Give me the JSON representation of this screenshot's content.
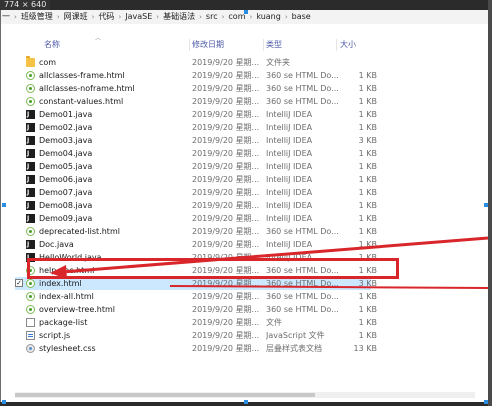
{
  "capture_size": "774 × 640",
  "breadcrumb": [
    "一",
    "班级管理",
    "网课班",
    "代码",
    "JavaSE",
    "基础语法",
    "src",
    "com",
    "kuang",
    "base"
  ],
  "columns": {
    "name": "名称",
    "date": "修改日期",
    "type": "类型",
    "size": "大小"
  },
  "files": [
    {
      "name": "com",
      "date": "2019/9/20 星期...",
      "type": "文件夹",
      "size": "",
      "icon": "folder-icon"
    },
    {
      "name": "allclasses-frame.html",
      "date": "2019/9/20 星期...",
      "type": "360 se HTML Do...",
      "size": "1 KB",
      "icon": "html-icon"
    },
    {
      "name": "allclasses-noframe.html",
      "date": "2019/9/20 星期...",
      "type": "360 se HTML Do...",
      "size": "1 KB",
      "icon": "html-icon"
    },
    {
      "name": "constant-values.html",
      "date": "2019/9/20 星期...",
      "type": "360 se HTML Do...",
      "size": "1 KB",
      "icon": "html-icon"
    },
    {
      "name": "Demo01.java",
      "date": "2019/9/20 星期...",
      "type": "IntelliJ IDEA",
      "size": "1 KB",
      "icon": "java-icon"
    },
    {
      "name": "Demo02.java",
      "date": "2019/9/20 星期...",
      "type": "IntelliJ IDEA",
      "size": "1 KB",
      "icon": "java-icon"
    },
    {
      "name": "Demo03.java",
      "date": "2019/9/20 星期...",
      "type": "IntelliJ IDEA",
      "size": "3 KB",
      "icon": "java-icon"
    },
    {
      "name": "Demo04.java",
      "date": "2019/9/20 星期...",
      "type": "IntelliJ IDEA",
      "size": "1 KB",
      "icon": "java-icon"
    },
    {
      "name": "Demo05.java",
      "date": "2019/9/20 星期...",
      "type": "IntelliJ IDEA",
      "size": "1 KB",
      "icon": "java-icon"
    },
    {
      "name": "Demo06.java",
      "date": "2019/9/20 星期...",
      "type": "IntelliJ IDEA",
      "size": "1 KB",
      "icon": "java-icon"
    },
    {
      "name": "Demo07.java",
      "date": "2019/9/20 星期...",
      "type": "IntelliJ IDEA",
      "size": "1 KB",
      "icon": "java-icon"
    },
    {
      "name": "Demo08.java",
      "date": "2019/9/20 星期...",
      "type": "IntelliJ IDEA",
      "size": "1 KB",
      "icon": "java-icon"
    },
    {
      "name": "Demo09.java",
      "date": "2019/9/20 星期...",
      "type": "IntelliJ IDEA",
      "size": "1 KB",
      "icon": "java-icon"
    },
    {
      "name": "deprecated-list.html",
      "date": "2019/9/20 星期...",
      "type": "360 se HTML Do...",
      "size": "1 KB",
      "icon": "html-icon"
    },
    {
      "name": "Doc.java",
      "date": "2019/9/20 星期...",
      "type": "IntelliJ IDEA",
      "size": "1 KB",
      "icon": "java-icon"
    },
    {
      "name": "HelloWorld.java",
      "date": "2019/9/20 星期...",
      "type": "IntelliJ IDEA",
      "size": "1 KB",
      "icon": "java-icon"
    },
    {
      "name": "help-doc.html",
      "date": "2019/9/20 星期...",
      "type": "360 se HTML Do...",
      "size": "1 KB",
      "icon": "html-icon"
    },
    {
      "name": "index.html",
      "date": "2019/9/20 星期...",
      "type": "360 se HTML Do...",
      "size": "3 KB",
      "icon": "html-icon",
      "selected": true
    },
    {
      "name": "index-all.html",
      "date": "2019/9/20 星期...",
      "type": "360 se HTML Do...",
      "size": "1 KB",
      "icon": "html-icon"
    },
    {
      "name": "overview-tree.html",
      "date": "2019/9/20 星期...",
      "type": "360 se HTML Do...",
      "size": "1 KB",
      "icon": "html-icon"
    },
    {
      "name": "package-list",
      "date": "2019/9/20 星期...",
      "type": "文件",
      "size": "1 KB",
      "icon": "file-icon"
    },
    {
      "name": "script.js",
      "date": "2019/9/20 星期...",
      "type": "JavaScript 文件",
      "size": "1 KB",
      "icon": "js-icon"
    },
    {
      "name": "stylesheet.css",
      "date": "2019/9/20 星期...",
      "type": "层叠样式表文档",
      "size": "13 KB",
      "icon": "css-icon"
    }
  ],
  "colors": {
    "selection": "#cce8ff",
    "annotation": "#d9262b",
    "header_text": "#4c5aa8"
  }
}
